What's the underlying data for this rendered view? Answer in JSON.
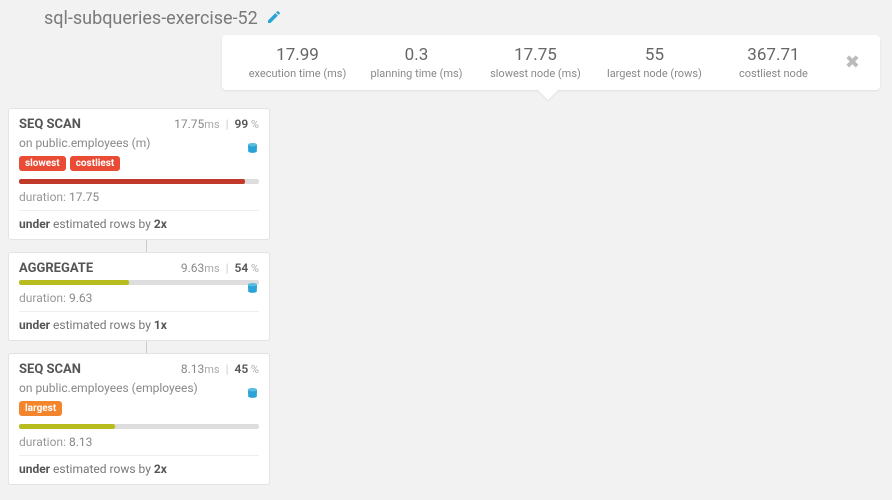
{
  "title": "sql-subqueries-exercise-52",
  "stats": [
    {
      "value": "17.99",
      "label": "execution time (ms)"
    },
    {
      "value": "0.3",
      "label": "planning time (ms)"
    },
    {
      "value": "17.75",
      "label": "slowest node (ms)"
    },
    {
      "value": "55",
      "label": "largest node (rows)"
    },
    {
      "value": "367.71",
      "label": "costliest node"
    }
  ],
  "nodes": [
    {
      "type": "SEQ SCAN",
      "ms": "17.75",
      "pct": "99",
      "subtitle": "on public.employees (m)",
      "tags": [
        {
          "text": "slowest",
          "cls": "tag-red"
        },
        {
          "text": "costliest",
          "cls": "tag-red"
        }
      ],
      "bar_pct": 94,
      "bar_cls": "bar-red",
      "duration": "17.75",
      "est_prefix": "under",
      "est_mid": " estimated rows by ",
      "est_factor": "2x",
      "db_icon_cls": ""
    },
    {
      "type": "AGGREGATE",
      "ms": "9.63",
      "pct": "54",
      "subtitle": "",
      "tags": [],
      "bar_pct": 46,
      "bar_cls": "bar-olive",
      "duration": "9.63",
      "est_prefix": "under",
      "est_mid": " estimated rows by ",
      "est_factor": "1x",
      "db_icon_cls": "agg"
    },
    {
      "type": "SEQ SCAN",
      "ms": "8.13",
      "pct": "45",
      "subtitle": "on public.employees (employees)",
      "tags": [
        {
          "text": "largest",
          "cls": "tag-orange"
        }
      ],
      "bar_pct": 40,
      "bar_cls": "bar-olive",
      "duration": "8.13",
      "est_prefix": "under",
      "est_mid": " estimated rows by ",
      "est_factor": "2x",
      "db_icon_cls": ""
    }
  ],
  "labels": {
    "ms_unit": "ms",
    "pct_unit": " %",
    "duration_label": "duration: "
  }
}
